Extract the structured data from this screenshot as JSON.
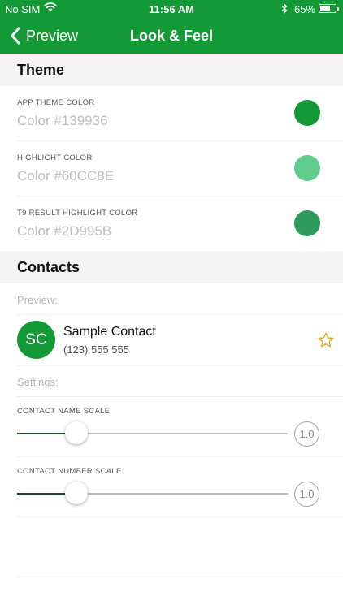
{
  "status_bar": {
    "carrier": "No SIM",
    "time": "11:56 AM",
    "battery_percent": "65%",
    "battery_level": 0.65
  },
  "nav": {
    "back_label": "Preview",
    "title": "Look & Feel"
  },
  "theme": {
    "header": "Theme",
    "colors": [
      {
        "caption": "APP THEME COLOR",
        "value": "Color #139936",
        "hex": "#139936"
      },
      {
        "caption": "HIGHLIGHT COLOR",
        "value": "Color #60CC8E",
        "hex": "#60CC8E"
      },
      {
        "caption": "T9 RESULT HIGHLIGHT COLOR",
        "value": "Color #2D995B",
        "hex": "#2D995B"
      }
    ]
  },
  "contacts": {
    "header": "Contacts",
    "preview_label": "Preview:",
    "sample": {
      "initials": "SC",
      "name": "Sample Contact",
      "number": "(123) 555 555",
      "favorite_color": "#E8A317"
    },
    "settings_label": "Settings:",
    "sliders": [
      {
        "caption": "CONTACT NAME SCALE",
        "display": "1.0",
        "position": 0.22
      },
      {
        "caption": "CONTACT NUMBER SCALE",
        "display": "1.0",
        "position": 0.22
      }
    ]
  },
  "icons": {
    "back": "chevron-left-icon",
    "wifi": "wifi-icon",
    "bluetooth": "bluetooth-icon",
    "battery": "battery-icon",
    "favorite": "star-outline-icon"
  }
}
